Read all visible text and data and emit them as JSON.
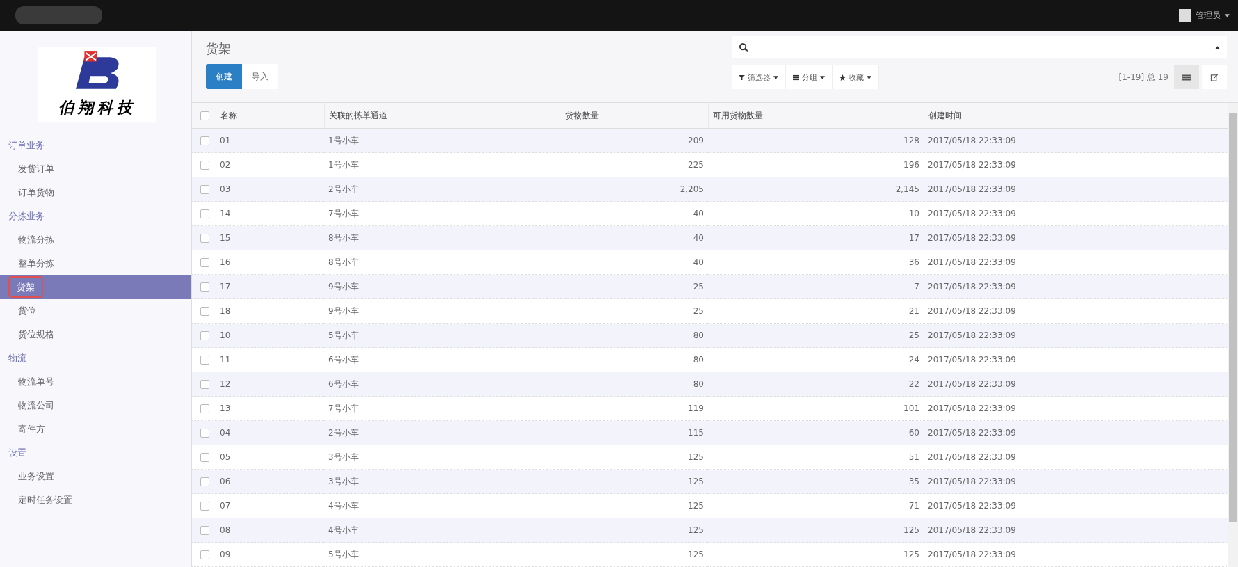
{
  "topbar": {
    "user": "管理员"
  },
  "sidebar": {
    "logo_text": "伯翔科技",
    "sections": [
      {
        "title": "订单业务",
        "items": [
          {
            "label": "发货订单",
            "selected": false
          },
          {
            "label": "订单货物",
            "selected": false
          }
        ]
      },
      {
        "title": "分拣业务",
        "items": [
          {
            "label": "物流分拣",
            "selected": false
          },
          {
            "label": "整单分拣",
            "selected": false
          },
          {
            "label": "货架",
            "selected": true
          },
          {
            "label": "货位",
            "selected": false
          },
          {
            "label": "货位规格",
            "selected": false
          }
        ]
      },
      {
        "title": "物流",
        "items": [
          {
            "label": "物流单号",
            "selected": false
          },
          {
            "label": "物流公司",
            "selected": false
          },
          {
            "label": "寄件方",
            "selected": false
          }
        ]
      },
      {
        "title": "设置",
        "items": [
          {
            "label": "业务设置",
            "selected": false
          },
          {
            "label": "定时任务设置",
            "selected": false
          }
        ]
      }
    ]
  },
  "page": {
    "title": "货架",
    "buttons": [
      {
        "label": "创建",
        "kind": "primary"
      },
      {
        "label": "导入",
        "kind": "default"
      }
    ],
    "filters": [
      {
        "label": "筛选器",
        "kind": "filter"
      },
      {
        "label": "分组",
        "kind": "group"
      },
      {
        "label": "收藏",
        "kind": "star"
      }
    ],
    "pager": "[1-19] 总 19"
  },
  "table": {
    "select_all_checked": false,
    "columns": [
      "名称",
      "关联的拣单通道",
      "货物数量",
      "可用货物数量",
      "创建时间"
    ],
    "rows": [
      {
        "checked": false,
        "cells": [
          "01",
          "1号小车",
          "209",
          "128",
          "2017/05/18 22:33:09"
        ]
      },
      {
        "checked": false,
        "cells": [
          "02",
          "1号小车",
          "225",
          "196",
          "2017/05/18 22:33:09"
        ]
      },
      {
        "checked": false,
        "cells": [
          "03",
          "2号小车",
          "2,205",
          "2,145",
          "2017/05/18 22:33:09"
        ]
      },
      {
        "checked": false,
        "cells": [
          "14",
          "7号小车",
          "40",
          "10",
          "2017/05/18 22:33:09"
        ]
      },
      {
        "checked": false,
        "cells": [
          "15",
          "8号小车",
          "40",
          "17",
          "2017/05/18 22:33:09"
        ]
      },
      {
        "checked": false,
        "cells": [
          "16",
          "8号小车",
          "40",
          "36",
          "2017/05/18 22:33:09"
        ]
      },
      {
        "checked": false,
        "cells": [
          "17",
          "9号小车",
          "25",
          "7",
          "2017/05/18 22:33:09"
        ]
      },
      {
        "checked": false,
        "cells": [
          "18",
          "9号小车",
          "25",
          "21",
          "2017/05/18 22:33:09"
        ]
      },
      {
        "checked": false,
        "cells": [
          "10",
          "5号小车",
          "80",
          "25",
          "2017/05/18 22:33:09"
        ]
      },
      {
        "checked": false,
        "cells": [
          "11",
          "6号小车",
          "80",
          "24",
          "2017/05/18 22:33:09"
        ]
      },
      {
        "checked": false,
        "cells": [
          "12",
          "6号小车",
          "80",
          "22",
          "2017/05/18 22:33:09"
        ]
      },
      {
        "checked": false,
        "cells": [
          "13",
          "7号小车",
          "119",
          "101",
          "2017/05/18 22:33:09"
        ]
      },
      {
        "checked": false,
        "cells": [
          "04",
          "2号小车",
          "115",
          "60",
          "2017/05/18 22:33:09"
        ]
      },
      {
        "checked": false,
        "cells": [
          "05",
          "3号小车",
          "125",
          "51",
          "2017/05/18 22:33:09"
        ]
      },
      {
        "checked": false,
        "cells": [
          "06",
          "3号小车",
          "125",
          "35",
          "2017/05/18 22:33:09"
        ]
      },
      {
        "checked": false,
        "cells": [
          "07",
          "4号小车",
          "125",
          "71",
          "2017/05/18 22:33:09"
        ]
      },
      {
        "checked": false,
        "cells": [
          "08",
          "4号小车",
          "125",
          "125",
          "2017/05/18 22:33:09"
        ]
      },
      {
        "checked": false,
        "cells": [
          "09",
          "5号小车",
          "125",
          "125",
          "2017/05/18 22:33:09"
        ]
      }
    ]
  }
}
